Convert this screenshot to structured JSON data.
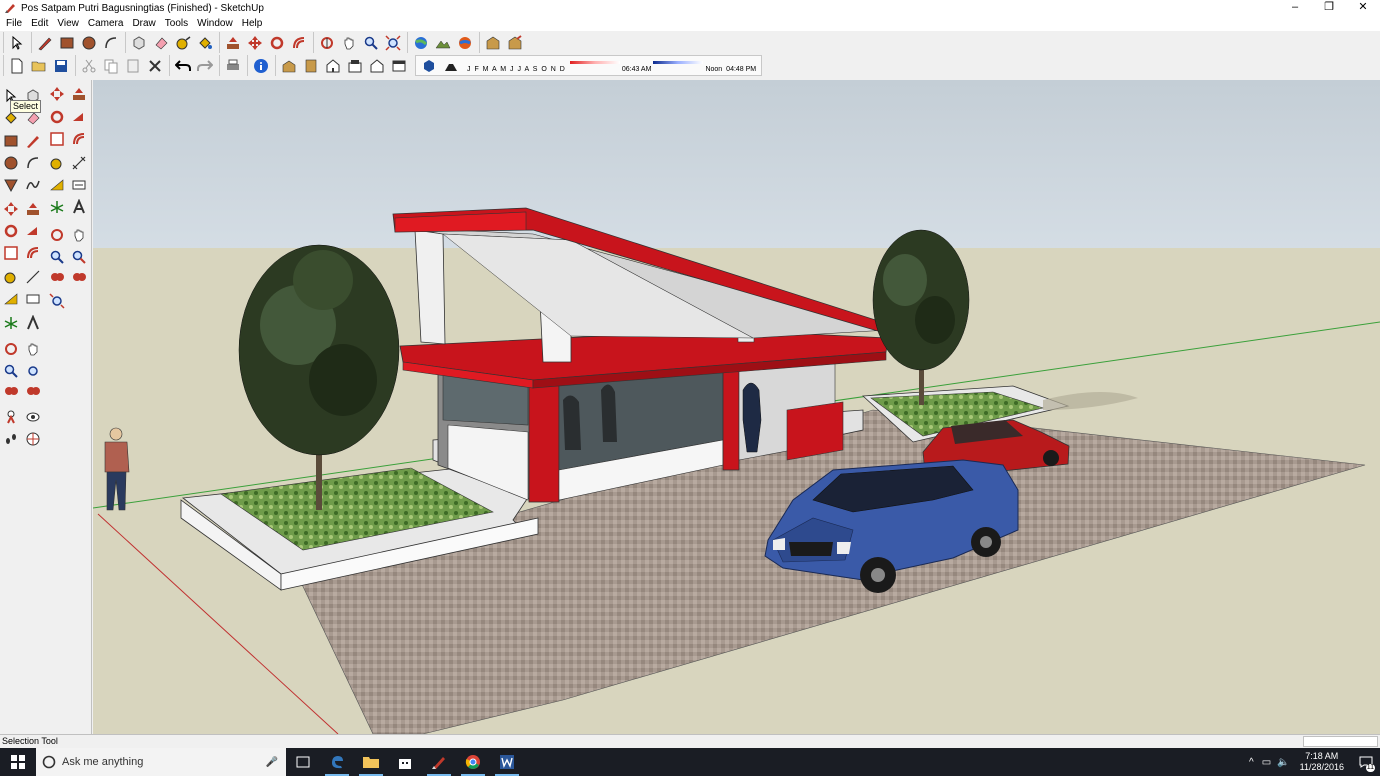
{
  "window": {
    "title": "Pos Satpam Putri Bagusningtias (Finished) - SketchUp",
    "controls": [
      "–",
      "❐",
      "✕"
    ]
  },
  "menu": [
    "File",
    "Edit",
    "View",
    "Camera",
    "Draw",
    "Tools",
    "Window",
    "Help"
  ],
  "shadow_settings": {
    "months": "J F M A M J J A S O N D",
    "start_time": "06:43 AM",
    "noon": "Noon",
    "end_time": "04:48 PM"
  },
  "tooltip": "Select",
  "status": {
    "text": "Selection Tool"
  },
  "taskbar": {
    "search_placeholder": "Ask me anything",
    "clock_time": "7:18 AM",
    "clock_date": "11/28/2016",
    "notif_count": "11"
  },
  "colors": {
    "roof_red": "#c8141c",
    "ground_sky": "#d6d4bd",
    "car_blue": "#3a5aa8",
    "car_red": "#b81a1c"
  }
}
